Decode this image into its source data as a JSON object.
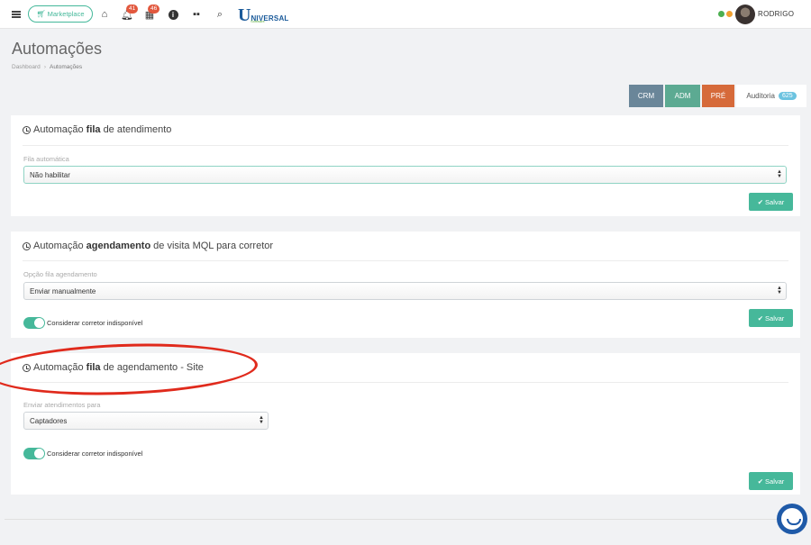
{
  "topbar": {
    "marketplace_label": "Marketplace",
    "notifications_count": "41",
    "calendar_count": "46",
    "logo_text_u": "U",
    "logo_text_rest": "NIVERSAL",
    "logo_sub": "Software",
    "username": "RODRIGO",
    "status_colors": [
      "#4caf50",
      "#f0a030"
    ]
  },
  "page": {
    "title": "Automações",
    "breadcrumb": [
      "Dashboard",
      "Automações"
    ]
  },
  "tabs": [
    {
      "label": "CRM",
      "color": "#6a8699"
    },
    {
      "label": "ADM",
      "color": "#5caa92"
    },
    {
      "label": "PRÉ",
      "color": "#d66a3a"
    },
    {
      "label": "Auditoria",
      "count": "625"
    }
  ],
  "cards": [
    {
      "title_prefix": "Automação ",
      "title_bold": "fila",
      "title_suffix": " de atendimento",
      "field_label": "Fila automática",
      "select_value": "Não habilitar",
      "save_label": "Salvar"
    },
    {
      "title_prefix": "Automação ",
      "title_bold": "agendamento",
      "title_suffix": " de visita MQL para corretor",
      "field_label": "Opção fila agendamento",
      "select_value": "Enviar manualmente",
      "toggle_label": "Considerar corretor indisponível",
      "toggle_on": true,
      "save_label": "Salvar"
    },
    {
      "title_prefix": "Automação ",
      "title_bold": "fila",
      "title_suffix": " de agendamento - Site",
      "field_label": "Enviar atendimentos para",
      "select_value": "Captadores",
      "toggle_label": "Considerar corretor indisponível",
      "toggle_on": true,
      "save_label": "Salvar"
    }
  ],
  "colors": {
    "accent": "#46b89a",
    "badge": "#e2583e",
    "annotation_red": "#e02a1c",
    "chat": "#1f5aa8"
  }
}
